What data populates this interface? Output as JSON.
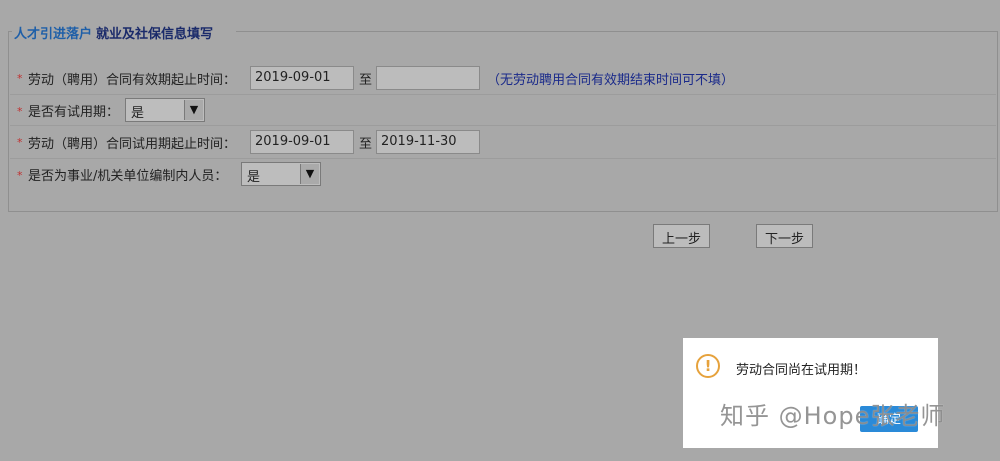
{
  "legend": {
    "crumb": "人才引进落户",
    "title": "就业及社保信息填写"
  },
  "form": {
    "contract_period": {
      "label": "劳动（聘用）合同有效期起止时间：",
      "start": "2019-09-01",
      "end": "",
      "to": "至",
      "hint": "（无劳动聘用合同有效期结束时间可不填）"
    },
    "has_probation": {
      "label": "是否有试用期：",
      "value": "是"
    },
    "probation_period": {
      "label": "劳动（聘用）合同试用期起止时间：",
      "start": "2019-09-01",
      "end": "2019-11-30",
      "to": "至"
    },
    "is_public_staff": {
      "label": "是否为事业/机关单位编制内人员：",
      "value": "是"
    },
    "required_mark": "*"
  },
  "buttons": {
    "prev": "上一步",
    "next": "下一步"
  },
  "dialog": {
    "message": "劳动合同尚在试用期！",
    "icon": "warning-icon",
    "ok": "确定"
  },
  "watermark": "知乎 @Hope张老师",
  "colors": {
    "accent": "#2a8ad8",
    "warning": "#e6a23c",
    "required": "#c03030"
  }
}
